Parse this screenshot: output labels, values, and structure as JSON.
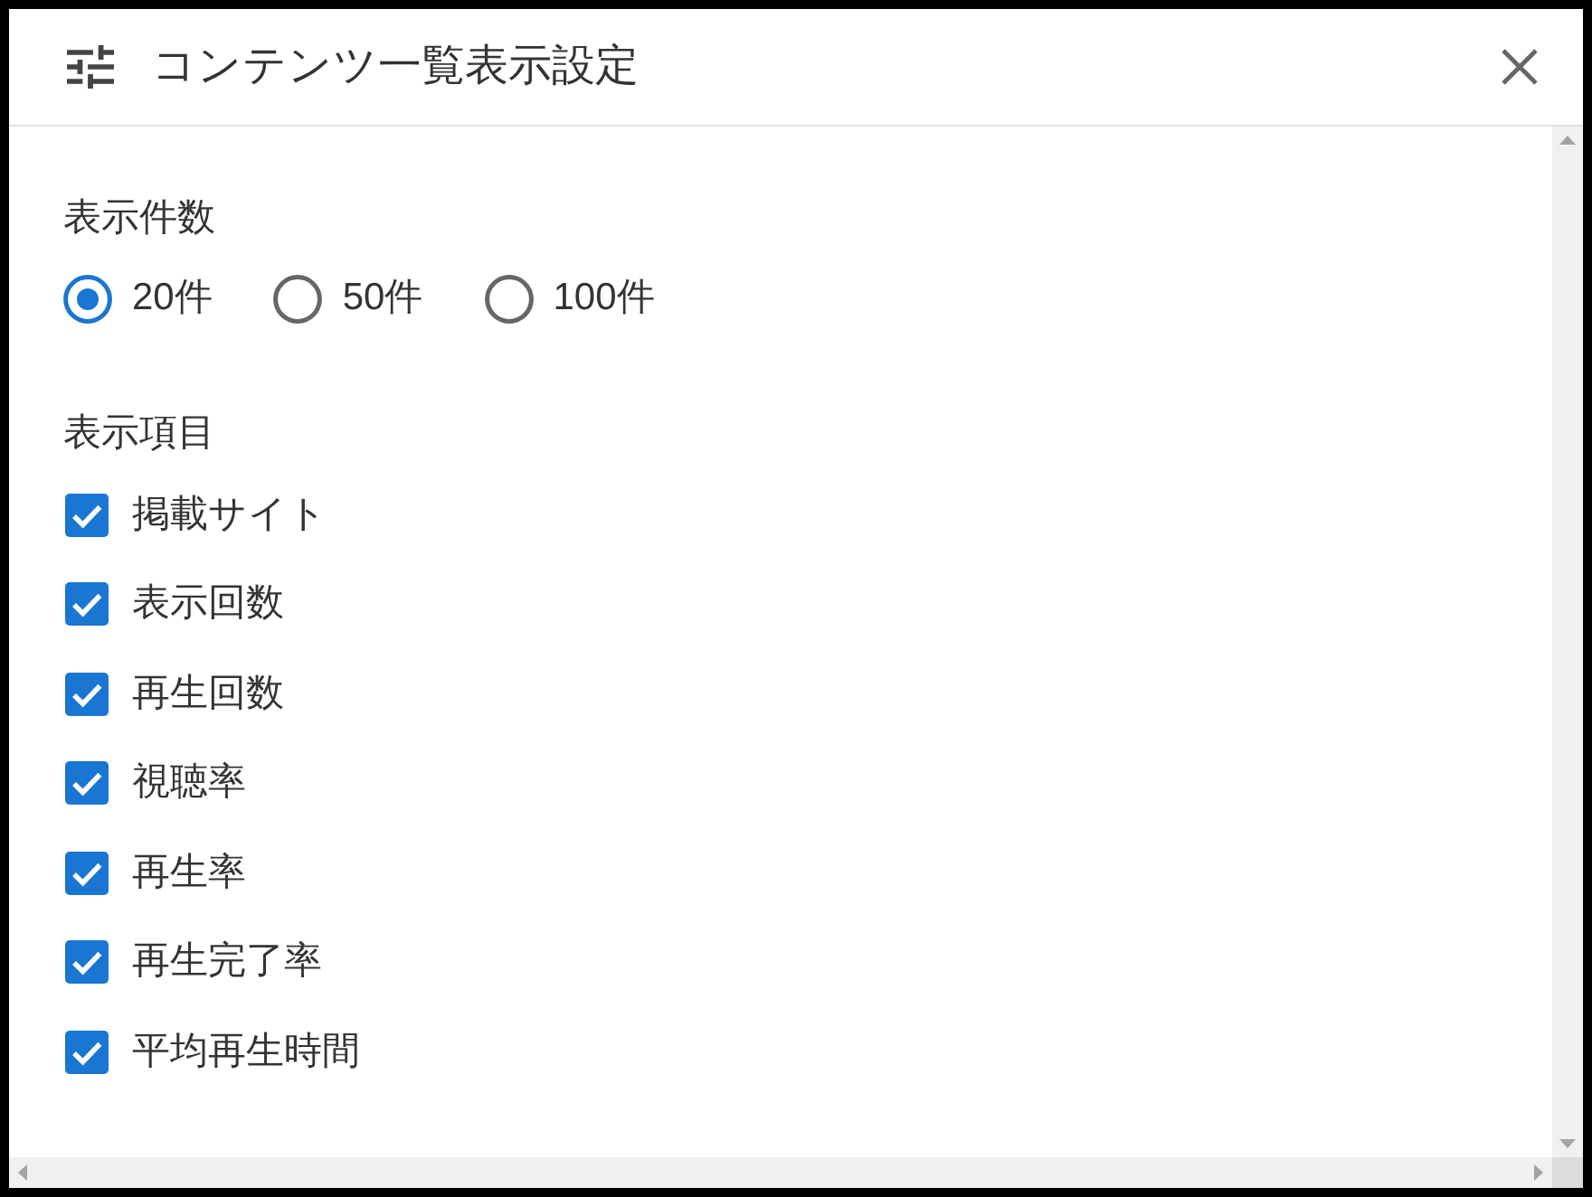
{
  "dialog": {
    "title": "コンテンツ一覧表示設定"
  },
  "sections": [
    {
      "kind": "radio",
      "label": "表示件数",
      "options": [
        {
          "label": "20件",
          "selected": true
        },
        {
          "label": "50件",
          "selected": false
        },
        {
          "label": "100件",
          "selected": false
        }
      ]
    },
    {
      "kind": "checkbox",
      "label": "表示項目",
      "options": [
        {
          "label": "掲載サイト",
          "checked": true
        },
        {
          "label": "表示回数",
          "checked": true
        },
        {
          "label": "再生回数",
          "checked": true
        },
        {
          "label": "視聴率",
          "checked": true
        },
        {
          "label": "再生率",
          "checked": true
        },
        {
          "label": "再生完了率",
          "checked": true
        },
        {
          "label": "平均再生時間",
          "checked": true
        }
      ]
    }
  ]
}
